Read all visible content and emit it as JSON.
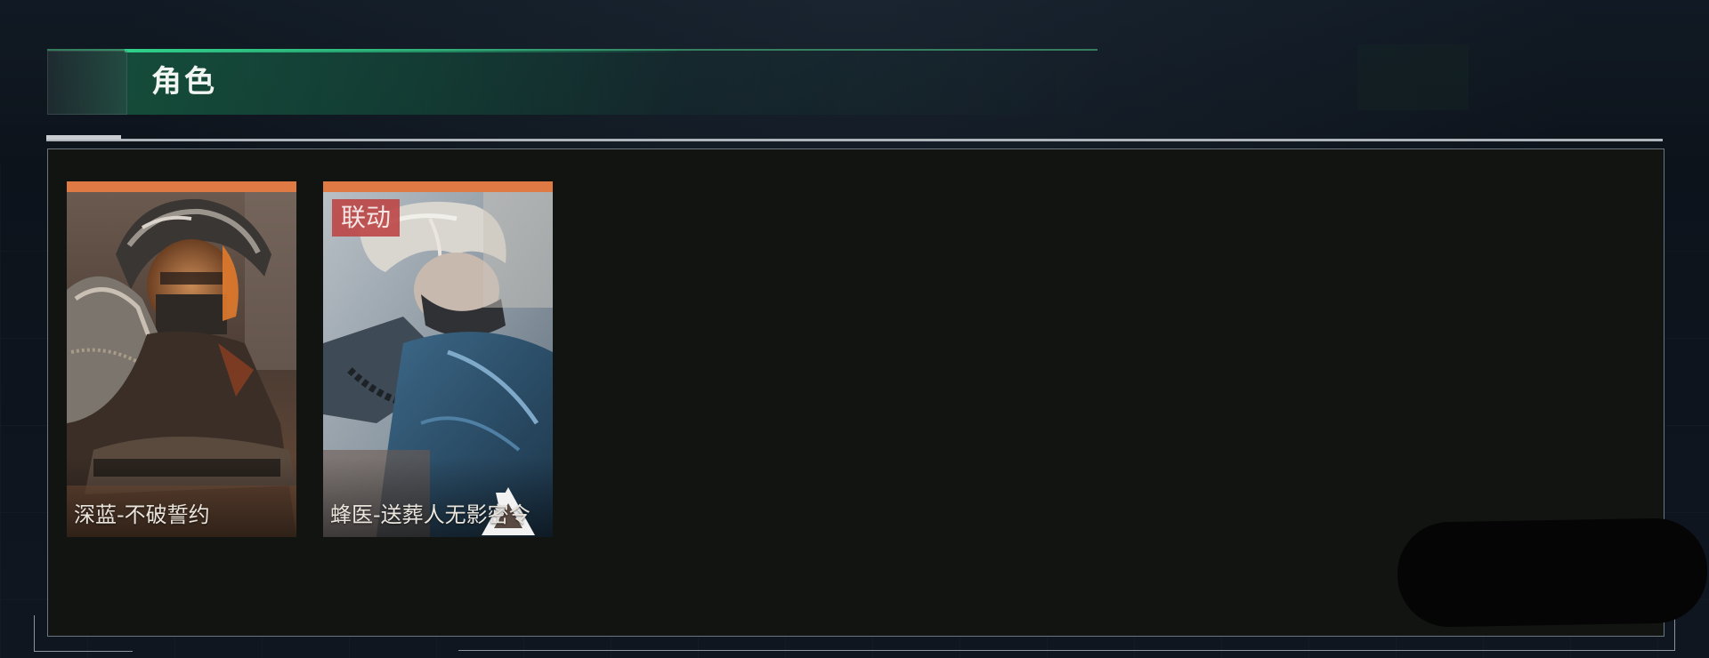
{
  "section": {
    "title": "角色"
  },
  "characters": [
    {
      "name": "深蓝-不破誓约",
      "rarity_color": "#e07a45",
      "tag": ""
    },
    {
      "name": "蜂医-送葬人无影密令",
      "rarity_color": "#e07a45",
      "tag": "联动"
    }
  ],
  "colors": {
    "accent_green": "#2fd08a",
    "rarity_orange": "#e07a45",
    "collab_red": "#be4646",
    "panel_bg": "#111411"
  },
  "icons": {
    "collab_logo": "triangle-logo-icon"
  }
}
